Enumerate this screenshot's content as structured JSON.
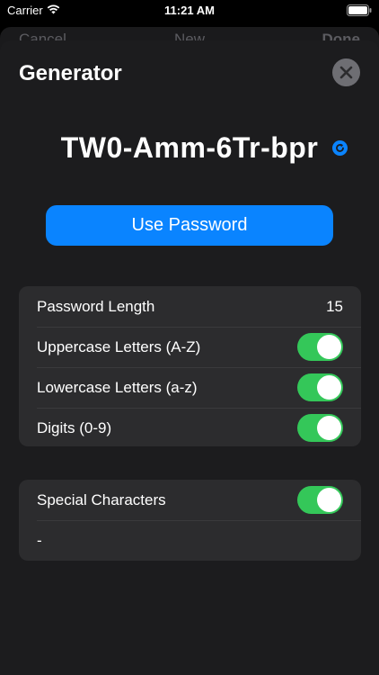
{
  "status": {
    "carrier": "Carrier",
    "time": "11:21 AM"
  },
  "behind_nav": {
    "cancel": "Cancel",
    "new": "New",
    "done": "Done"
  },
  "sheet": {
    "title": "Generator",
    "password": "TW0-Amm-6Tr-bpr",
    "use_button": "Use Password"
  },
  "settings": {
    "length_label": "Password Length",
    "length_value": "15",
    "uppercase_label": "Uppercase Letters (A-Z)",
    "uppercase_on": true,
    "lowercase_label": "Lowercase Letters (a-z)",
    "lowercase_on": true,
    "digits_label": "Digits (0-9)",
    "digits_on": true,
    "special_label": "Special Characters",
    "special_on": true,
    "special_value": "-"
  },
  "colors": {
    "accent": "#0a84ff",
    "toggle_on": "#34c759"
  },
  "icons": {
    "wifi": "wifi-icon",
    "battery": "battery-icon",
    "close": "close-icon",
    "refresh": "refresh-icon"
  }
}
